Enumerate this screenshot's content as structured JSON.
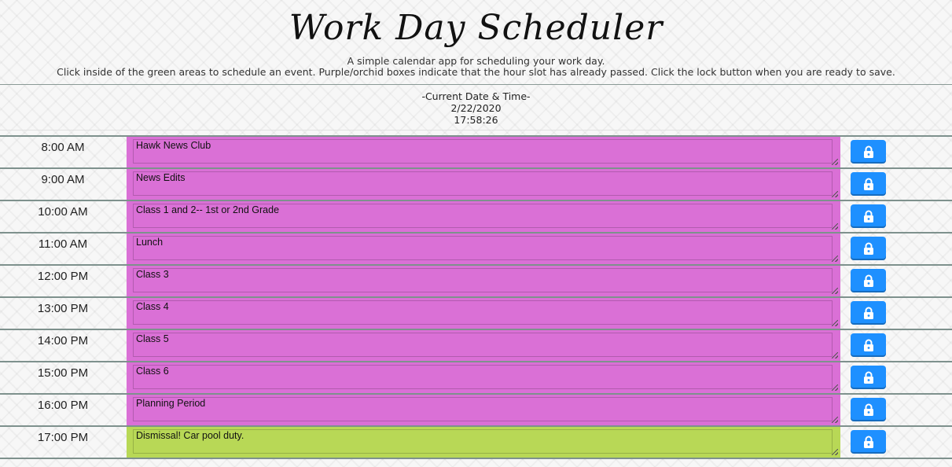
{
  "header": {
    "title": "Work Day Scheduler",
    "subtitle": "A simple calendar app for scheduling your work day.",
    "instructions": "Click inside of the green areas to schedule an event. Purple/orchid boxes indicate that the hour slot has already passed. Click the lock button when you are ready to save."
  },
  "datetime": {
    "label": "-Current Date & Time-",
    "date": "2/22/2020",
    "time": "17:58:26"
  },
  "colors": {
    "past": "#da70d6",
    "present": "#b8d856",
    "save_button": "#1e90ff"
  },
  "rows": [
    {
      "hour": "8:00 AM",
      "event": "Hawk News Club",
      "status": "past",
      "icon": "lock-icon"
    },
    {
      "hour": "9:00 AM",
      "event": "News Edits",
      "status": "past",
      "icon": "lock-icon"
    },
    {
      "hour": "10:00 AM",
      "event": "Class 1 and 2-- 1st or 2nd Grade",
      "status": "past",
      "icon": "lock-icon"
    },
    {
      "hour": "11:00 AM",
      "event": "Lunch",
      "status": "past",
      "icon": "lock-icon"
    },
    {
      "hour": "12:00 PM",
      "event": "Class 3",
      "status": "past",
      "icon": "lock-icon"
    },
    {
      "hour": "13:00 PM",
      "event": "Class 4",
      "status": "past",
      "icon": "lock-icon"
    },
    {
      "hour": "14:00 PM",
      "event": "Class 5",
      "status": "past",
      "icon": "lock-icon"
    },
    {
      "hour": "15:00 PM",
      "event": "Class 6",
      "status": "past",
      "icon": "lock-icon"
    },
    {
      "hour": "16:00 PM",
      "event": "Planning Period",
      "status": "past",
      "icon": "lock-icon"
    },
    {
      "hour": "17:00 PM",
      "event": "Dismissal! Car pool duty.",
      "status": "present",
      "icon": "lock-icon"
    }
  ]
}
